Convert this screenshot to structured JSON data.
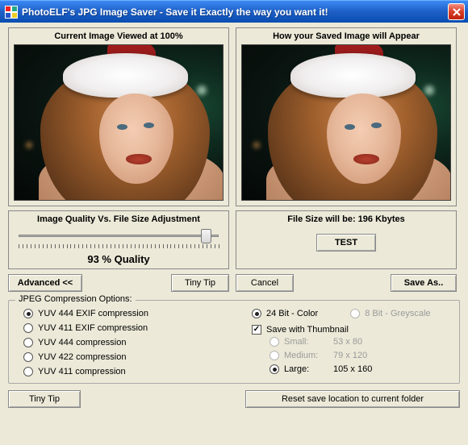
{
  "window": {
    "title": "PhotoELF's JPG Image Saver - Save it Exactly the way you want it!"
  },
  "preview": {
    "left_header": "Current Image Viewed at 100%",
    "right_header": "How your Saved Image will Appear"
  },
  "quality": {
    "label": "Image Quality Vs. File Size Adjustment",
    "value_text": "93 % Quality",
    "slider_percent": 93
  },
  "filesize": {
    "label": "File Size will be: 196 Kbytes",
    "test_label": "TEST"
  },
  "actions": {
    "advanced": "Advanced <<",
    "tinytip": "Tiny Tip",
    "cancel": "Cancel",
    "saveas": "Save As.."
  },
  "compression": {
    "legend": "JPEG Compression Options:",
    "options": [
      "YUV 444  EXIF  compression",
      "YUV 411  EXIF  compression",
      "YUV 444  compression",
      "YUV 422  compression",
      "YUV 411  compression"
    ],
    "selected_index": 0
  },
  "color": {
    "bit24": "24 Bit - Color",
    "bit8": "8 Bit - Greyscale"
  },
  "thumbnail": {
    "label": "Save with Thumbnail",
    "opts": [
      {
        "name": "Small:",
        "dims": "53 x 80"
      },
      {
        "name": "Medium:",
        "dims": "79 x 120"
      },
      {
        "name": "Large:",
        "dims": "105 x 160"
      }
    ],
    "selected_index": 2
  },
  "footer": {
    "tinytip": "Tiny Tip",
    "reset": "Reset save location to current folder"
  }
}
